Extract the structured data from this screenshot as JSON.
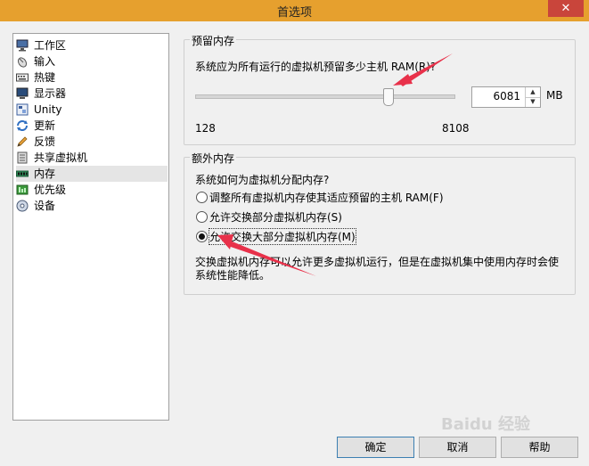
{
  "window": {
    "title": "首选项",
    "close_glyph": "✕"
  },
  "sidebar": {
    "items": [
      {
        "label": "工作区",
        "icon": "workspace-icon"
      },
      {
        "label": "输入",
        "icon": "mouse-icon"
      },
      {
        "label": "热键",
        "icon": "keyboard-icon"
      },
      {
        "label": "显示器",
        "icon": "monitor-icon"
      },
      {
        "label": "Unity",
        "icon": "unity-icon"
      },
      {
        "label": "更新",
        "icon": "refresh-icon"
      },
      {
        "label": "反馈",
        "icon": "pencil-icon"
      },
      {
        "label": "共享虚拟机",
        "icon": "shared-vm-icon"
      },
      {
        "label": "内存",
        "icon": "memory-icon",
        "selected": true
      },
      {
        "label": "优先级",
        "icon": "priority-icon"
      },
      {
        "label": "设备",
        "icon": "device-icon"
      }
    ]
  },
  "reserved_memory": {
    "group_title": "预留内存",
    "prompt": "系统应为所有运行的虚拟机预留多少主机 RAM(R)?",
    "slider": {
      "min": 128,
      "max": 8108,
      "value": 6081
    },
    "min_label": "128",
    "max_label": "8108",
    "value_text": "6081",
    "unit": "MB",
    "spin_up": "▲",
    "spin_down": "▼"
  },
  "extra_memory": {
    "group_title": "额外内存",
    "prompt": "系统如何为虚拟机分配内存?",
    "options": [
      {
        "label": "调整所有虚拟机内存使其适应预留的主机 RAM(F)",
        "selected": false
      },
      {
        "label": "允许交换部分虚拟机内存(S)",
        "selected": false
      },
      {
        "label": "允许交换大部分虚拟机内存(M)",
        "selected": true
      }
    ],
    "note_line1": "交换虚拟机内存可以允许更多虚拟机运行，但是在虚拟机集中使用内存时会使",
    "note_line2": "系统性能降低。"
  },
  "buttons": {
    "ok": "确定",
    "cancel": "取消",
    "help": "帮助"
  },
  "watermark": "Baidu 经验",
  "colors": {
    "titlebar": "#e6a02e",
    "close": "#c9453b",
    "annotation_arrow": "#e8314a",
    "default_button_border": "#3c7fb1"
  }
}
